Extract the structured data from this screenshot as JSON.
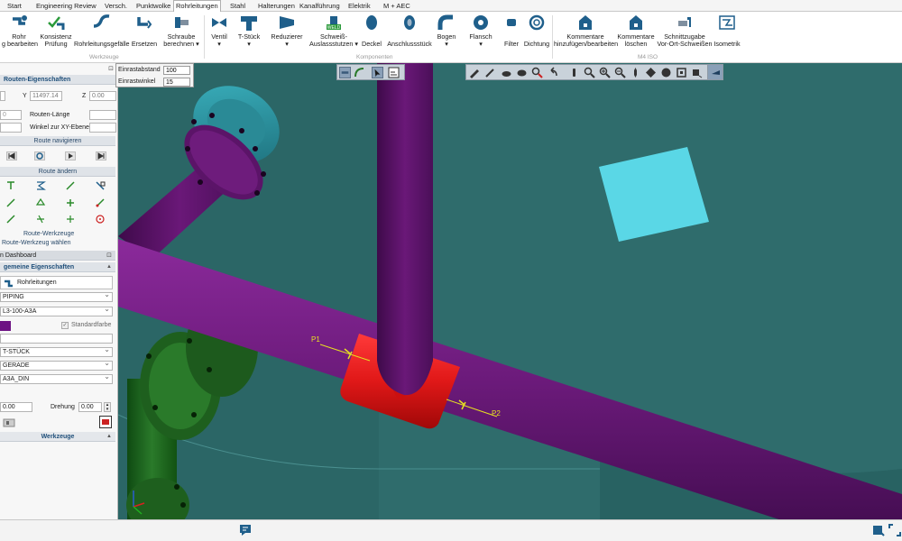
{
  "tabs": [
    "Start",
    "Engineering Review",
    "Versch.",
    "Punktwolke",
    "Rohrleitungen",
    "Stahl",
    "Halterungen",
    "Kanalführung",
    "Elektrik",
    "M + AEC"
  ],
  "active_tab": "Rohrleitungen",
  "ribbon": {
    "groups": {
      "werkzeuge": "Werkzeuge",
      "komponenten": "Komponenten",
      "m4iso": "M4 ISO"
    },
    "buttons": {
      "rohr": [
        "Rohr",
        "g bearbeiten"
      ],
      "konsistenz": [
        "Konsistenz",
        "Prüfung"
      ],
      "gefaelle": [
        "",
        "Rohrleitungsgefälle"
      ],
      "ersetzen": [
        "",
        "Ersetzen"
      ],
      "schraube": [
        "Schraube",
        "berechnen ▾"
      ],
      "ventil": [
        "Ventil",
        "▾"
      ],
      "tstueck": [
        "T-Stück",
        "▾"
      ],
      "reduzierer": [
        "Reduzierer",
        "▾"
      ],
      "schweiss": [
        "Schweiß-",
        "Auslassstutzen ▾"
      ],
      "deckel": [
        "",
        "Deckel"
      ],
      "anschluss": [
        "",
        "Anschlussstück"
      ],
      "bogen": [
        "Bogen",
        "▾"
      ],
      "flansch": [
        "Flansch",
        "▾"
      ],
      "filter": [
        "",
        "Filter"
      ],
      "dichtung": [
        "",
        "Dichtung"
      ],
      "kommentare_add": [
        "Kommentare",
        "hinzufügen/bearbeiten"
      ],
      "kommentare_del": [
        "Kommentare",
        "löschen"
      ],
      "schnittzugabe": [
        "Schnittzugabe",
        "Vor-Ort-Schweißen"
      ],
      "isometrik": [
        "",
        "Isometrik"
      ]
    }
  },
  "weld_label": "WELD",
  "popup": {
    "einrastabstand_label": "Einrastabstand",
    "einrastabstand_value": "100",
    "einrastwinkel_label": "Einrastwinkel",
    "einrastwinkel_value": "15"
  },
  "left_panel": {
    "routen_title": "Routen-Eigenschaften",
    "x_value": "",
    "y_label": "Y",
    "y_value": "11497.14",
    "z_label": "Z",
    "z_value": "0.00",
    "routen_laenge_label": "Routen-Länge",
    "routen_laenge_small": "0",
    "winkel_label": "Winkel zur XY-Ebene",
    "route_navigieren": "Route navigieren",
    "route_aendern": "Route ändern",
    "route_werkzeuge": "Route-Werkzeuge",
    "route_werkzeug_waehlen": "Route-Werkzeug wählen",
    "dashboard": "n Dashboard",
    "allg_eig": "gemeine Eigenschaften",
    "rohrleitungen_btn": "Rohrleitungen",
    "piping": "PIPING",
    "spec": "L3-100-A3A",
    "standardfarbe": "Standardfarbe",
    "tstueck": "T-STÜCK",
    "gerade": "GERADE",
    "a3a_din": "A3A_DIN",
    "val1": "0.00",
    "drehung_label": "Drehung",
    "drehung_value": "0.00",
    "werkzeuge": "Werkzeuge"
  },
  "viewport": {
    "p1_label": "P1",
    "p2_label": "P2"
  },
  "colors": {
    "pipe_purple": "#6b1a7a",
    "tee_red": "#e01818",
    "flange_teal": "#2a8a96",
    "green_pipe": "#1f6a1f",
    "vessel": "#2f6c6c",
    "marker_cyan": "#5ad7e6",
    "label_yellow": "#e6e021",
    "color_swatch": "#6d1283"
  }
}
